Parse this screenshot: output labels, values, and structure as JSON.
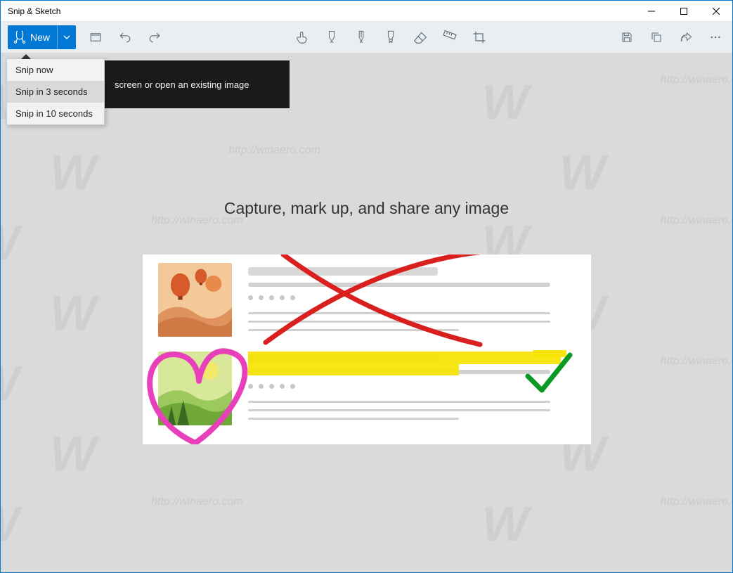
{
  "window": {
    "title": "Snip & Sketch"
  },
  "toolbar": {
    "new_label": "New",
    "icons": {
      "snip": "snip-icon",
      "chevron": "chevron-down-icon",
      "open": "open-file-icon",
      "undo": "undo-icon",
      "redo": "redo-icon",
      "touch": "touch-writing-icon",
      "ballpoint": "ballpoint-pen-icon",
      "pencil": "pencil-icon",
      "highlighter": "highlighter-icon",
      "eraser": "eraser-icon",
      "ruler": "ruler-icon",
      "crop": "crop-icon",
      "save": "save-icon",
      "copy": "copy-icon",
      "share": "share-icon",
      "more": "more-icon"
    }
  },
  "dropdown": {
    "items": [
      {
        "label": "Snip now"
      },
      {
        "label": "Snip in 3 seconds"
      },
      {
        "label": "Snip in 10 seconds"
      }
    ]
  },
  "tooltip": {
    "text": "screen or open an existing image"
  },
  "content": {
    "headline": "Capture, mark up, and share any image"
  },
  "watermark": {
    "text": "http://winaero.com"
  }
}
